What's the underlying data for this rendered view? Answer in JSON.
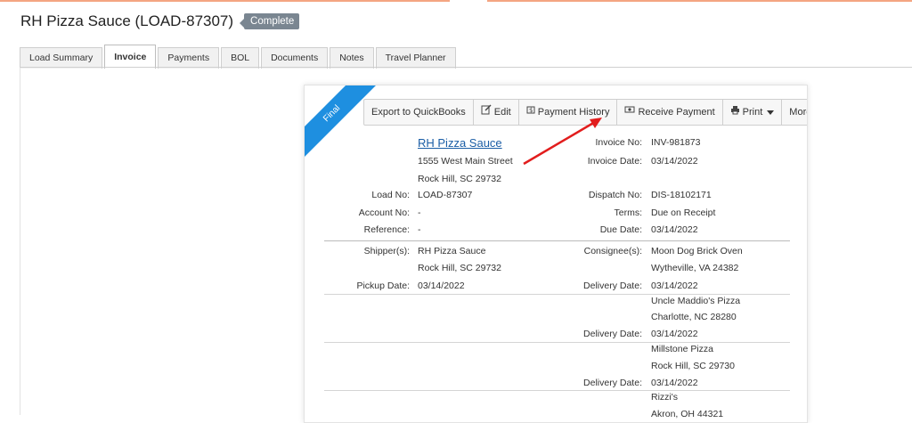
{
  "page": {
    "title": "RH Pizza Sauce (LOAD-87307)",
    "status_badge": "Complete"
  },
  "tabs": [
    {
      "label": "Load Summary"
    },
    {
      "label": "Invoice"
    },
    {
      "label": "Payments"
    },
    {
      "label": "BOL"
    },
    {
      "label": "Documents"
    },
    {
      "label": "Notes"
    },
    {
      "label": "Travel Planner"
    }
  ],
  "invoice": {
    "ribbon": "Final",
    "toolbar": {
      "export": "Export to QuickBooks",
      "edit": "Edit",
      "payment_history": "Payment History",
      "receive_payment": "Receive Payment",
      "print": "Print",
      "more": "More"
    },
    "bill_to": {
      "name": "RH Pizza Sauce",
      "address1": "1555 West Main Street",
      "address2": "Rock Hill, SC 29732"
    },
    "invoice_no": {
      "label": "Invoice No:",
      "value": "INV-981873"
    },
    "invoice_date": {
      "label": "Invoice Date:",
      "value": "03/14/2022"
    },
    "load_no": {
      "label": "Load No:",
      "value": "LOAD-87307"
    },
    "dispatch_no": {
      "label": "Dispatch No:",
      "value": "DIS-18102171"
    },
    "account_no": {
      "label": "Account No:",
      "value": "-"
    },
    "terms": {
      "label": "Terms:",
      "value": "Due on Receipt"
    },
    "reference": {
      "label": "Reference:",
      "value": "-"
    },
    "due_date": {
      "label": "Due Date:",
      "value": "03/14/2022"
    },
    "shipper": {
      "label": "Shipper(s):",
      "name": "RH Pizza Sauce",
      "city": "Rock Hill, SC 29732"
    },
    "pickup": {
      "label": "Pickup Date:",
      "value": "03/14/2022"
    },
    "consignee_label": "Consignee(s):",
    "delivery_label": "Delivery Date:",
    "consignees": [
      {
        "name": "Moon Dog Brick Oven",
        "city": "Wytheville, VA 24382",
        "date": "03/14/2022"
      },
      {
        "name": "Uncle Maddio's Pizza",
        "city": "Charlotte, NC 28280",
        "date": "03/14/2022"
      },
      {
        "name": "Millstone Pizza",
        "city": "Rock Hill, SC 29730",
        "date": "03/14/2022"
      },
      {
        "name": "Rizzi's",
        "city": "Akron, OH 44321"
      }
    ]
  },
  "colors": {
    "accent_top": "#f4a582",
    "ribbon": "#1e8fe0",
    "badge": "#7a8691",
    "annotation_arrow": "#e21d1d"
  }
}
